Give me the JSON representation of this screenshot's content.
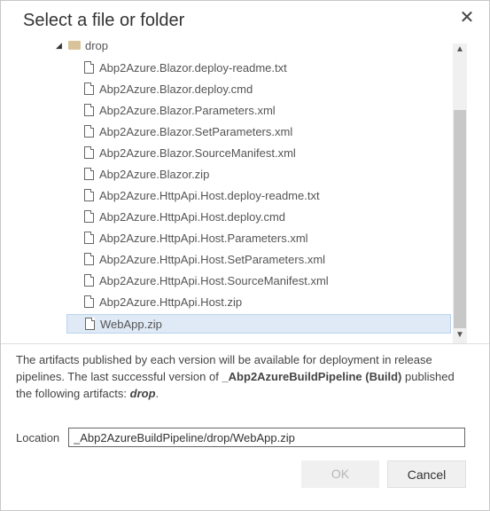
{
  "dialog": {
    "title": "Select a file or folder",
    "close_glyph": "✕"
  },
  "tree": {
    "folder": {
      "label": "drop",
      "icon": "folder-icon",
      "expand_glyph": "◢"
    },
    "files": [
      "Abp2Azure.Blazor.deploy-readme.txt",
      "Abp2Azure.Blazor.deploy.cmd",
      "Abp2Azure.Blazor.Parameters.xml",
      "Abp2Azure.Blazor.SetParameters.xml",
      "Abp2Azure.Blazor.SourceManifest.xml",
      "Abp2Azure.Blazor.zip",
      "Abp2Azure.HttpApi.Host.deploy-readme.txt",
      "Abp2Azure.HttpApi.Host.deploy.cmd",
      "Abp2Azure.HttpApi.Host.Parameters.xml",
      "Abp2Azure.HttpApi.Host.SetParameters.xml",
      "Abp2Azure.HttpApi.Host.SourceManifest.xml",
      "Abp2Azure.HttpApi.Host.zip",
      "WebApp.zip"
    ],
    "selected_index": 12
  },
  "scrollbar": {
    "up_glyph": "▲",
    "down_glyph": "▼"
  },
  "info": {
    "part1": "The artifacts published by each version will be available for deployment in release pipelines. The last successful version of ",
    "pipeline": "_Abp2AzureBuildPipeline (Build)",
    "part2": " published the following artifacts: ",
    "artifact": "drop",
    "part3": "."
  },
  "location": {
    "label": "Location",
    "value": "_Abp2AzureBuildPipeline/drop/WebApp.zip"
  },
  "buttons": {
    "ok": "OK",
    "cancel": "Cancel"
  },
  "colors": {
    "selection_bg": "#dfeaf6",
    "folder": "#d8c39b",
    "disabled_text": "#b5b5b5"
  }
}
